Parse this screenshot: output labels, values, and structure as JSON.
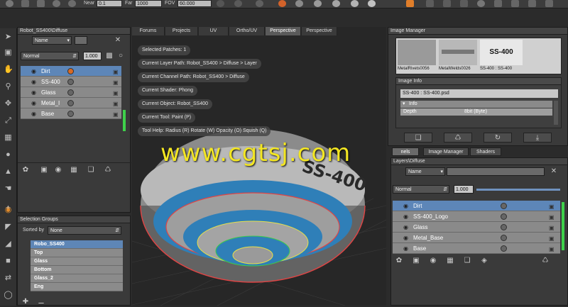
{
  "toolbar": {
    "near_label": "Near",
    "near_value": "0.1",
    "far_label": "Far",
    "far_value": "1000",
    "fov_label": "FOV",
    "fov_value": "60.000"
  },
  "layers_left": {
    "title": "Robot_SS400\\Diffuse",
    "search_mode": "Name",
    "blend_mode": "Normal",
    "opacity": "1.000",
    "items": [
      {
        "label": "Dirt",
        "selected": true
      },
      {
        "label": "SS-400",
        "selected": false
      },
      {
        "label": "Glass",
        "selected": false
      },
      {
        "label": "Metal_I",
        "selected": false
      },
      {
        "label": "Base",
        "selected": false
      }
    ]
  },
  "selection_groups": {
    "title": "Selection Groups",
    "sorted_by_label": "Sorted by",
    "sorted_by_value": "None",
    "items": [
      {
        "label": "Robo_SS400",
        "selected": true
      },
      {
        "label": "Top",
        "selected": false
      },
      {
        "label": "Glass",
        "selected": false
      },
      {
        "label": "Bottom",
        "selected": false
      },
      {
        "label": "Glass_2",
        "selected": false
      },
      {
        "label": "Eng",
        "selected": false
      }
    ]
  },
  "viewport": {
    "tabs": [
      {
        "label": "Forums",
        "active": false
      },
      {
        "label": "Projects",
        "active": false
      },
      {
        "label": "UV",
        "active": false
      },
      {
        "label": "Ortho/UV",
        "active": false
      },
      {
        "label": "Perspective",
        "active": true
      },
      {
        "label": "Perspective",
        "active": false
      }
    ],
    "info": [
      "Selected Patches: 1",
      "Current Layer Path: Robot_SS400 > Diffuse > Layer",
      "Current Channel Path: Robot_SS400 > Diffuse",
      "Current Shader: Phong",
      "Current Object: Robot_SS400",
      "Current Tool: Paint (P)",
      "Tool Help:  Radius (R)  Rotate (W)  Opacity (O)  Squish (Q)"
    ],
    "model_text": "SS-400",
    "watermark": "www.cgtsj.com"
  },
  "image_manager": {
    "title": "Image Manager",
    "thumbs": [
      {
        "caption": "MetalRivets0056"
      },
      {
        "caption": "MetalWelds0026"
      },
      {
        "caption": "SS-400 : SS-400",
        "text": "SS-400"
      }
    ],
    "image_info_title": "Image Info",
    "image_name": "SS-400 : SS-400.psd",
    "info_label": "Info",
    "depth_label": "Depth",
    "depth_value": "8bit  (Byte)"
  },
  "right_tabs": [
    {
      "label": "nels",
      "active": true
    },
    {
      "label": "Image Manager",
      "active": false
    },
    {
      "label": "Shaders",
      "active": false
    }
  ],
  "layers_right": {
    "title": "Layers\\Diffuse",
    "search_mode": "Name",
    "blend_mode": "Normal",
    "opacity": "1.000",
    "items": [
      {
        "label": "Dirt",
        "selected": true
      },
      {
        "label": "SS-400_Logo",
        "selected": false
      },
      {
        "label": "Glass",
        "selected": false
      },
      {
        "label": "Metal_Base",
        "selected": false
      },
      {
        "label": "Base",
        "selected": false
      }
    ]
  },
  "colors": {
    "accent_blue": "#5d86b8",
    "green_bar": "#3fd14b",
    "watermark_yellow": "#f3e623"
  }
}
